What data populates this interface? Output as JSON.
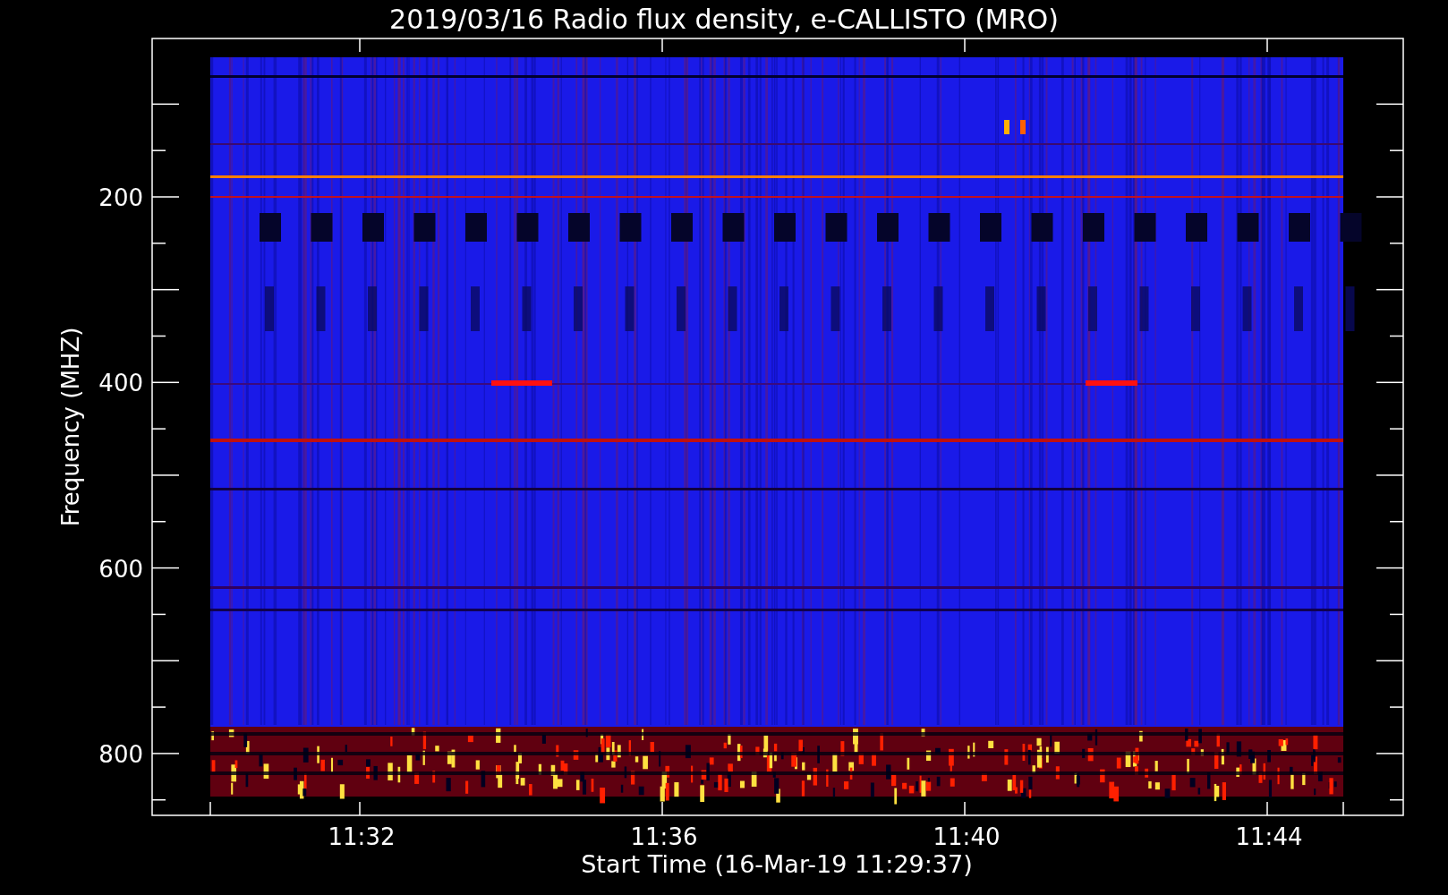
{
  "title": "2019/03/16  Radio flux density, e-CALLISTO (MRO)",
  "y_axis": {
    "label": "Frequency (MHZ)",
    "ticks": [
      "200",
      "400",
      "600",
      "800"
    ]
  },
  "x_axis": {
    "label": "Start Time (16-Mar-19 11:29:37)",
    "ticks": [
      "11:32",
      "11:36",
      "11:40",
      "11:44"
    ]
  }
}
